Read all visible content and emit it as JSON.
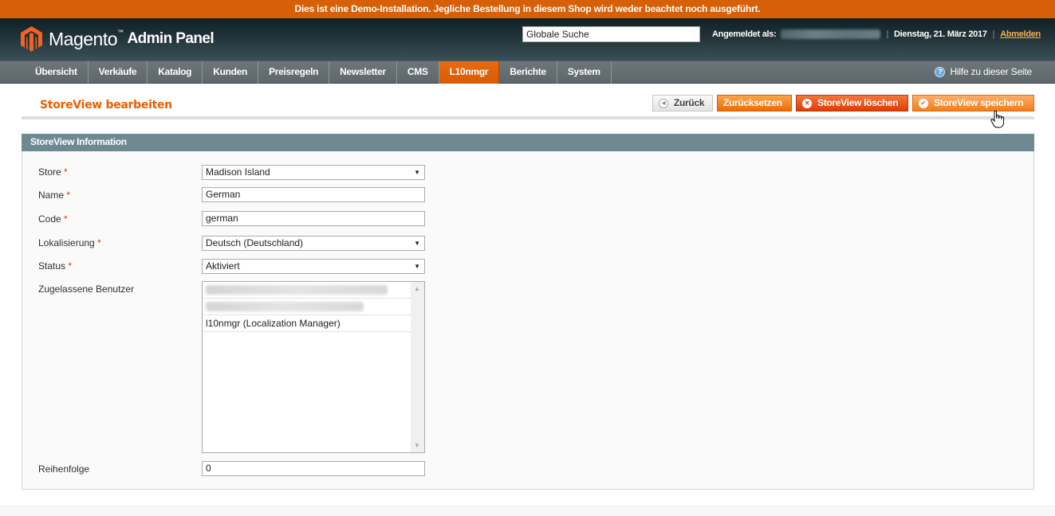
{
  "demo_notice": "Dies ist eine Demo-Installation. Jegliche Bestellung in diesem Shop wird weder beachtet noch ausgeführt.",
  "header": {
    "logo_brand": "Magento",
    "logo_tm": "™",
    "logo_subtitle": "Admin Panel",
    "search_value": "Globale Suche",
    "logged_in_label": "Angemeldet als:",
    "date": "Dienstag, 21. März 2017",
    "logout_label": "Abmelden"
  },
  "nav": {
    "items": [
      {
        "label": "Übersicht",
        "active": false
      },
      {
        "label": "Verkäufe",
        "active": false
      },
      {
        "label": "Katalog",
        "active": false
      },
      {
        "label": "Kunden",
        "active": false
      },
      {
        "label": "Preisregeln",
        "active": false
      },
      {
        "label": "Newsletter",
        "active": false
      },
      {
        "label": "CMS",
        "active": false
      },
      {
        "label": "L10nmgr",
        "active": true
      },
      {
        "label": "Berichte",
        "active": false
      },
      {
        "label": "System",
        "active": false
      }
    ],
    "help_label": "Hilfe zu dieser Seite"
  },
  "page": {
    "title": "StoreView bearbeiten",
    "buttons": {
      "back": "Zurück",
      "reset": "Zurücksetzen",
      "delete": "StoreView löschen",
      "save": "StoreView speichern"
    }
  },
  "form": {
    "section_title": "StoreView Information",
    "required_marker": "*",
    "store": {
      "label": "Store",
      "value": "Madison Island"
    },
    "name": {
      "label": "Name",
      "value": "German"
    },
    "code": {
      "label": "Code",
      "value": "german"
    },
    "locale": {
      "label": "Lokalisierung",
      "value": "Deutsch (Deutschland)"
    },
    "status": {
      "label": "Status",
      "value": "Aktiviert"
    },
    "allowed_users": {
      "label": "Zugelassene Benutzer",
      "options": [
        "[blurred]",
        "[blurred]",
        "l10nmgr (Localization Manager)"
      ]
    },
    "sort_order": {
      "label": "Reihenfolge",
      "value": "0"
    }
  },
  "colors": {
    "accent_orange": "#eb5e00",
    "banner": "#d75f07",
    "section_header": "#6f8992"
  }
}
